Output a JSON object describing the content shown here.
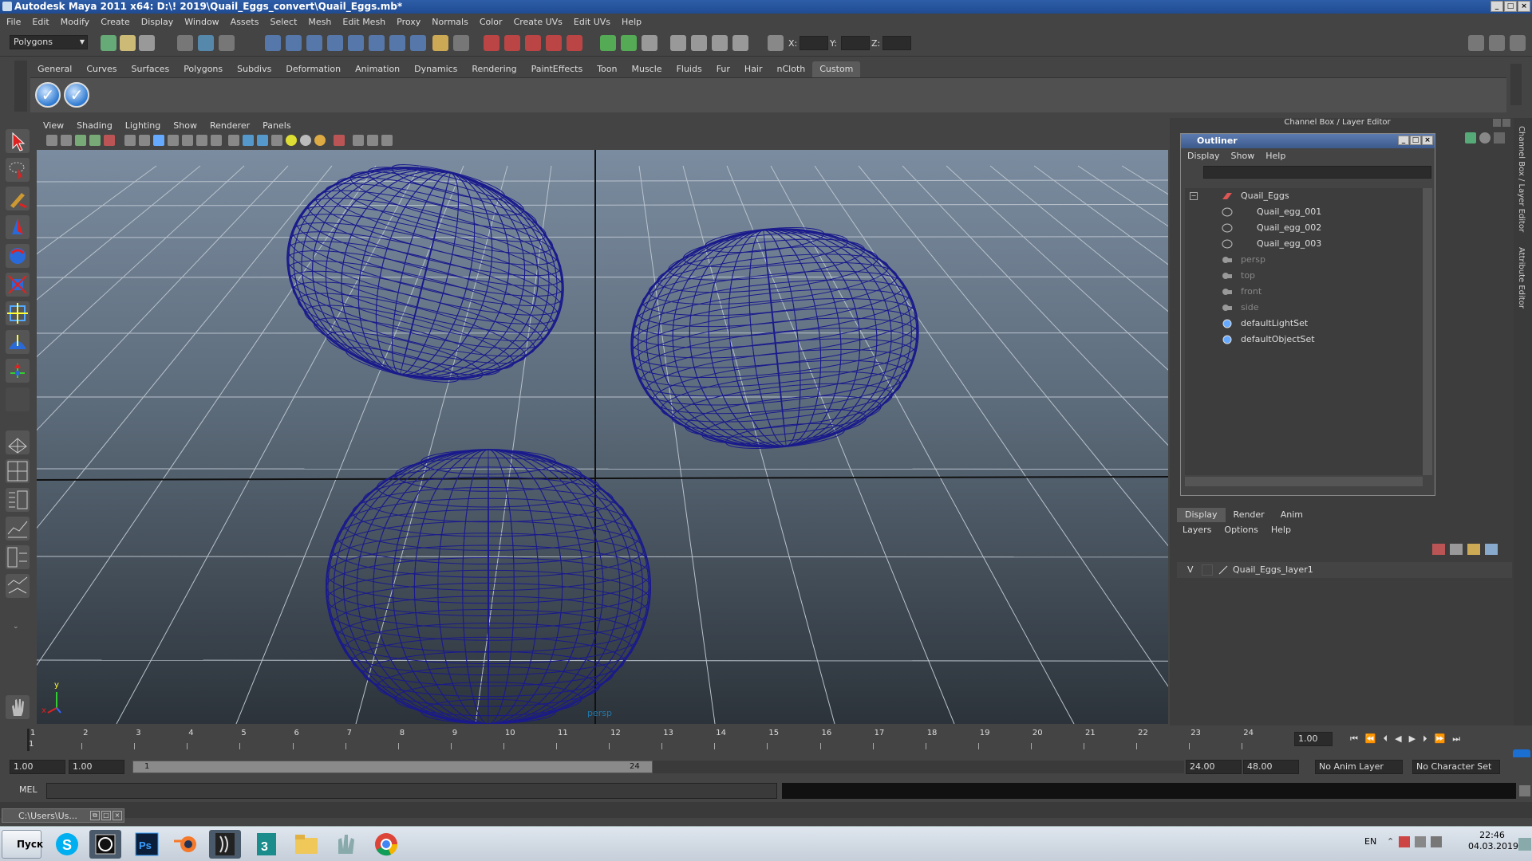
{
  "window": {
    "title": "Autodesk Maya 2011 x64: D:\\! 2019\\Quail_Eggs_convert\\Quail_Eggs.mb*"
  },
  "menubar": [
    "File",
    "Edit",
    "Modify",
    "Create",
    "Display",
    "Window",
    "Assets",
    "Select",
    "Mesh",
    "Edit Mesh",
    "Proxy",
    "Normals",
    "Color",
    "Create UVs",
    "Edit UVs",
    "Help"
  ],
  "statusline": {
    "mode": "Polygons",
    "x_label": "X:",
    "y_label": "Y:",
    "z_label": "Z:"
  },
  "shelf": {
    "tabs": [
      "General",
      "Curves",
      "Surfaces",
      "Polygons",
      "Subdivs",
      "Deformation",
      "Animation",
      "Dynamics",
      "Rendering",
      "PaintEffects",
      "Toon",
      "Muscle",
      "Fluids",
      "Fur",
      "Hair",
      "nCloth",
      "Custom"
    ],
    "active": "Custom"
  },
  "viewport": {
    "menu": [
      "View",
      "Shading",
      "Lighting",
      "Show",
      "Renderer",
      "Panels"
    ],
    "camera_label": "persp",
    "axis_y": "y",
    "axis_x": "x",
    "wire_color": "#1a1a8c"
  },
  "channel_box": {
    "header": "Channel Box / Layer Editor",
    "side_tabs": [
      "Channel Box / Layer Editor",
      "Attribute Editor"
    ]
  },
  "outliner": {
    "title": "Outliner",
    "menu": [
      "Display",
      "Show",
      "Help"
    ],
    "items": [
      {
        "label": "Quail_Eggs",
        "dim": false
      },
      {
        "label": "Quail_egg_001",
        "dim": false
      },
      {
        "label": "Quail_egg_002",
        "dim": false
      },
      {
        "label": "Quail_egg_003",
        "dim": false
      },
      {
        "label": "persp",
        "dim": true
      },
      {
        "label": "top",
        "dim": true
      },
      {
        "label": "front",
        "dim": true
      },
      {
        "label": "side",
        "dim": true
      },
      {
        "label": "defaultLightSet",
        "dim": false
      },
      {
        "label": "defaultObjectSet",
        "dim": false
      }
    ]
  },
  "layer_editor": {
    "tabs": [
      "Display",
      "Render",
      "Anim"
    ],
    "active_tab": "Display",
    "menu": [
      "Layers",
      "Options",
      "Help"
    ],
    "layers": [
      {
        "visible": "V",
        "name": "Quail_Eggs_layer1"
      }
    ]
  },
  "timeline": {
    "ticks": [
      "1",
      "2",
      "3",
      "4",
      "5",
      "6",
      "7",
      "8",
      "9",
      "10",
      "11",
      "12",
      "13",
      "14",
      "15",
      "16",
      "17",
      "18",
      "19",
      "20",
      "21",
      "22",
      "23",
      "24"
    ],
    "current_frame": "1.00",
    "current_marker": "1",
    "range_start": "1.00",
    "playback_start": "1.00",
    "range_inner_start": "1",
    "range_inner_end": "24",
    "playback_end": "24.00",
    "range_end": "48.00",
    "anim_layer": "No Anim Layer",
    "character_set": "No Character Set"
  },
  "command_line": {
    "label": "MEL"
  },
  "taskbar_window": {
    "title": "C:\\Users\\Us..."
  },
  "taskbar": {
    "start_label": "Пуск",
    "apps": [
      "skype-icon",
      "maya-icon",
      "photoshop-icon",
      "blender-icon",
      "zbrush-icon",
      "3dsmax-icon",
      "explorer-icon",
      "app-icon",
      "chrome-icon"
    ],
    "lang": "EN",
    "time": "22:46",
    "date": "04.03.2019"
  }
}
